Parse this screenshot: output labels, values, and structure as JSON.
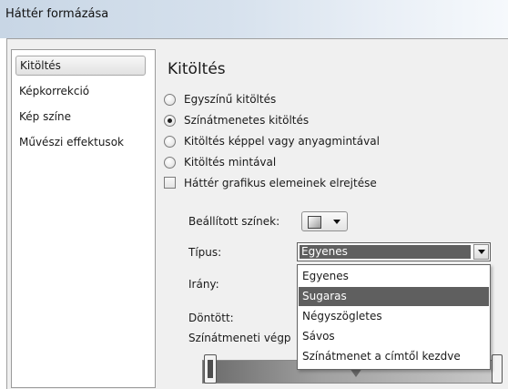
{
  "window": {
    "title": "Háttér formázása"
  },
  "sidebar": {
    "items": [
      {
        "label": "Kitöltés",
        "selected": true
      },
      {
        "label": "Képkorrekció",
        "selected": false
      },
      {
        "label": "Kép színe",
        "selected": false
      },
      {
        "label": "Művészi effektusok",
        "selected": false
      }
    ]
  },
  "main": {
    "section_title": "Kitöltés",
    "fill_options": [
      {
        "label": "Egyszínű kitöltés",
        "checked": false
      },
      {
        "label": "Színátmenetes kitöltés",
        "checked": true
      },
      {
        "label": "Kitöltés képpel vagy anyagmintával",
        "checked": false
      },
      {
        "label": "Kitöltés mintával",
        "checked": false
      }
    ],
    "hide_background_graphics": {
      "label": "Háttér grafikus elemeinek elrejtése",
      "checked": false
    },
    "preset_colors_label": "Beállított színek:",
    "type_label": "Típus:",
    "type_value": "Egyenes",
    "direction_label": "Irány:",
    "angle_label": "Döntött:",
    "gradient_stops_label": "Színátmeneti végp",
    "type_options": [
      "Egyenes",
      "Sugaras",
      "Négyszögletes",
      "Sávos",
      "Színátmenet a címtől kezdve"
    ],
    "type_highlighted": "Sugaras"
  },
  "icons": {
    "preset_colors": "gradient-swatch-icon",
    "dropdown_arrow": "chevron-down-icon"
  },
  "colors": {
    "selection": "#5f5f5f",
    "title_gradient_start": "#c8d6e5"
  }
}
